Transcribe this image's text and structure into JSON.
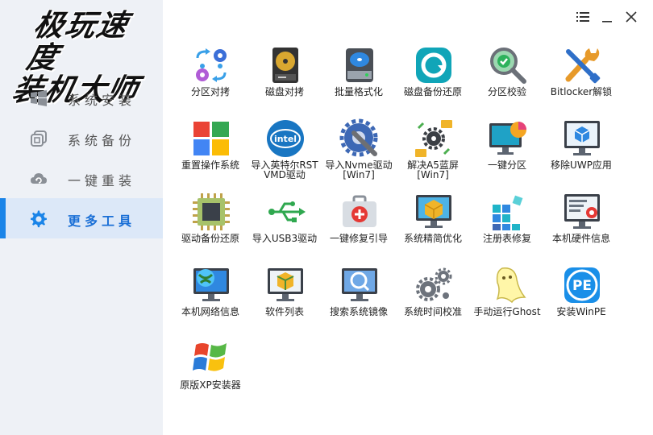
{
  "app": {
    "title_line1": "极玩速度",
    "title_line2": "装机大师"
  },
  "sidebar": {
    "items": [
      {
        "label": "系统安装",
        "icon": "windows-icon",
        "active": false
      },
      {
        "label": "系统备份",
        "icon": "copy-icon",
        "active": false
      },
      {
        "label": "一键重装",
        "icon": "cloud-refresh-icon",
        "active": false
      },
      {
        "label": "更多工具",
        "icon": "gear-icon",
        "active": true
      }
    ]
  },
  "window_controls": [
    "menu-icon",
    "minimize-icon",
    "close-icon"
  ],
  "colors": {
    "accent": "#1a84e8",
    "sidebar_bg": "#eef1f6",
    "active_bg": "#dce8f8"
  },
  "tools": [
    {
      "label": "分区对拷",
      "icon": "gears-sync-icon"
    },
    {
      "label": "磁盘对拷",
      "icon": "hard-drive-icon"
    },
    {
      "label": "批量格式化",
      "icon": "disk-format-icon"
    },
    {
      "label": "磁盘备份还原",
      "icon": "backup-restore-icon"
    },
    {
      "label": "分区校验",
      "icon": "magnifier-check-icon"
    },
    {
      "label": "Bitlocker解锁",
      "icon": "wrench-screwdriver-icon"
    },
    {
      "label": "重置操作系统",
      "icon": "windows-logo-icon"
    },
    {
      "label": "导入英特尔RST\nVMD驱动",
      "icon": "intel-icon"
    },
    {
      "label": "导入Nvme驱动\n[Win7]",
      "icon": "gear-wrench-icon"
    },
    {
      "label": "解决A5蓝屏\n[Win7]",
      "icon": "gear-folders-icon"
    },
    {
      "label": "一键分区",
      "icon": "monitor-pie-icon"
    },
    {
      "label": "移除UWP应用",
      "icon": "monitor-cube-icon"
    },
    {
      "label": "驱动备份还原",
      "icon": "chip-icon"
    },
    {
      "label": "导入USB3驱动",
      "icon": "usb-icon"
    },
    {
      "label": "一键修复引导",
      "icon": "first-aid-kit-icon"
    },
    {
      "label": "系统精简优化",
      "icon": "monitor-box-icon"
    },
    {
      "label": "注册表修复",
      "icon": "registry-cubes-icon"
    },
    {
      "label": "本机硬件信息",
      "icon": "monitor-settings-icon"
    },
    {
      "label": "本机网络信息",
      "icon": "monitor-globe-icon"
    },
    {
      "label": "软件列表",
      "icon": "monitor-package-icon"
    },
    {
      "label": "搜索系统镜像",
      "icon": "monitor-search-icon"
    },
    {
      "label": "系统时间校准",
      "icon": "gears-time-icon"
    },
    {
      "label": "手动运行Ghost",
      "icon": "ghost-icon"
    },
    {
      "label": "安装WinPE",
      "icon": "pe-icon"
    },
    {
      "label": "原版XP安装器",
      "icon": "windows-xp-logo-icon"
    }
  ]
}
